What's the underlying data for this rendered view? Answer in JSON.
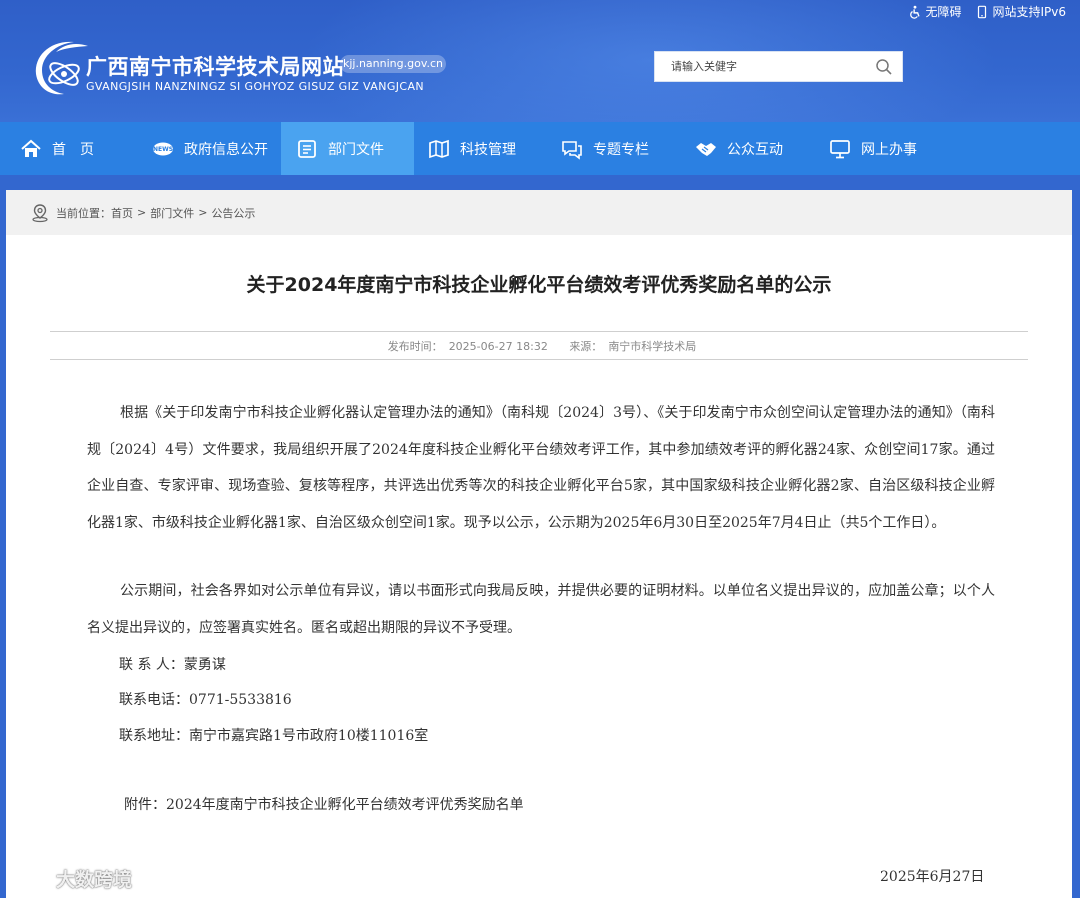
{
  "header": {
    "toplinks": [
      "无障碍",
      "网站支持IPv6"
    ],
    "site_title": "广西南宁市科学技术局网站",
    "domain": "kjj.nanning.gov.cn",
    "subtitle": "GVANGJSIH NANZNINGZ SI GOHYOZ GISUZ GIZ VANGJCAN",
    "search_placeholder": "请输入关健字"
  },
  "nav": {
    "items": [
      {
        "label": "首　页",
        "icon": "home-icon"
      },
      {
        "label": "政府信息公开",
        "icon": "news-icon"
      },
      {
        "label": "部门文件",
        "icon": "document-icon",
        "active": true
      },
      {
        "label": "科技管理",
        "icon": "map-icon"
      },
      {
        "label": "专题专栏",
        "icon": "chat-icon"
      },
      {
        "label": "公众互动",
        "icon": "handshake-icon"
      },
      {
        "label": "网上办事",
        "icon": "monitor-icon"
      }
    ]
  },
  "breadcrumb": {
    "prefix": "当前位置：",
    "items": [
      "首页",
      "部门文件",
      "公告公示"
    ],
    "separator": ">"
  },
  "article": {
    "title": "关于2024年度南宁市科技企业孵化平台绩效考评优秀奖励名单的公示",
    "publish_label": "发布时间：",
    "publish_time": "2025-06-27 18:32",
    "source_label": "来源：",
    "source": "南宁市科学技术局",
    "paragraphs": [
      "根据《关于印发南宁市科技企业孵化器认定管理办法的通知》（南科规〔2024〕3号）、《关于印发南宁市众创空间认定管理办法的通知》（南科规〔2024〕4号）文件要求，我局组织开展了2024年度科技企业孵化平台绩效考评工作，其中参加绩效考评的孵化器24家、众创空间17家。通过企业自查、专家评审、现场查验、复核等程序，共评选出优秀等次的科技企业孵化平台5家，其中国家级科技企业孵化器2家、自治区级科技企业孵化器1家、市级科技企业孵化器1家、自治区级众创空间1家。现予以公示，公示期为2025年6月30日至2025年7月4日止（共5个工作日）。",
      "公示期间，社会各界如对公示单位有异议，请以书面形式向我局反映，并提供必要的证明材料。以单位名义提出异议的，应加盖公章；以个人名义提出异议的，应签署真实姓名。匿名或超出期限的异议不予受理。"
    ],
    "contact_person": "联 系 人：蒙勇谋",
    "contact_phone": "联系电话：0771-5533816",
    "contact_address": "联系地址：南宁市嘉宾路1号市政府10楼11016室",
    "attachment": "附件：2024年度南宁市科技企业孵化平台绩效考评优秀奖励名单",
    "date": "2025年6月27日"
  },
  "watermark": "大数跨境",
  "colors": {
    "header_bg": "#3367cf",
    "nav_bg": "#2b80e2",
    "nav_active": "#4aa3f0",
    "breadcrumb_bg": "#f1f1f1"
  }
}
